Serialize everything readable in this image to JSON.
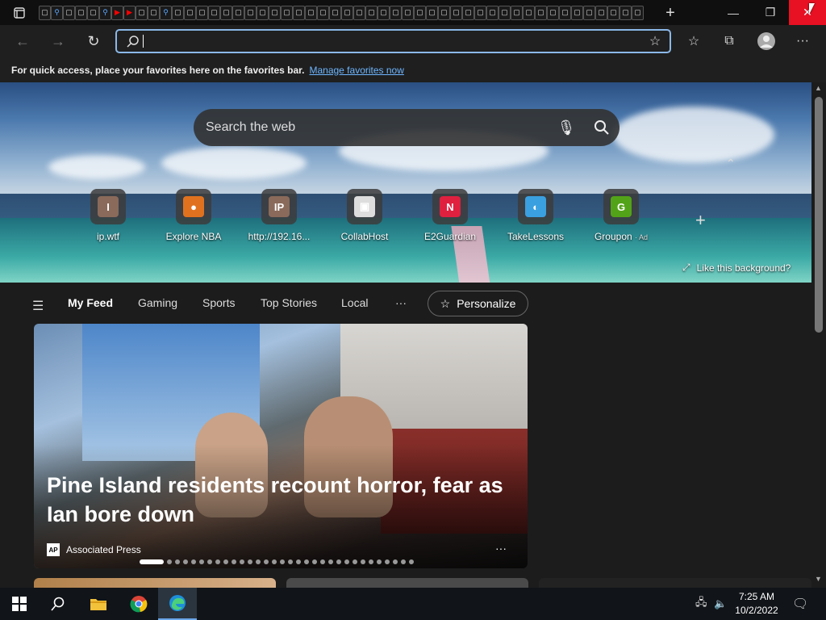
{
  "browser": {
    "tabs": [
      {
        "kind": "page"
      },
      {
        "kind": "search"
      },
      {
        "kind": "page"
      },
      {
        "kind": "page"
      },
      {
        "kind": "page"
      },
      {
        "kind": "search"
      },
      {
        "kind": "youtube"
      },
      {
        "kind": "youtube"
      },
      {
        "kind": "page"
      },
      {
        "kind": "page"
      },
      {
        "kind": "search"
      },
      {
        "kind": "page"
      },
      {
        "kind": "page"
      },
      {
        "kind": "page"
      },
      {
        "kind": "page"
      },
      {
        "kind": "page"
      },
      {
        "kind": "page"
      },
      {
        "kind": "page"
      },
      {
        "kind": "page"
      },
      {
        "kind": "page"
      },
      {
        "kind": "page"
      },
      {
        "kind": "page"
      },
      {
        "kind": "page"
      },
      {
        "kind": "page"
      },
      {
        "kind": "page"
      },
      {
        "kind": "page"
      },
      {
        "kind": "page"
      },
      {
        "kind": "page"
      },
      {
        "kind": "page"
      },
      {
        "kind": "page"
      },
      {
        "kind": "page"
      },
      {
        "kind": "page"
      },
      {
        "kind": "page"
      },
      {
        "kind": "page"
      },
      {
        "kind": "page"
      },
      {
        "kind": "page"
      },
      {
        "kind": "page"
      },
      {
        "kind": "page"
      },
      {
        "kind": "page"
      },
      {
        "kind": "page"
      },
      {
        "kind": "page"
      },
      {
        "kind": "page"
      },
      {
        "kind": "page"
      },
      {
        "kind": "page"
      },
      {
        "kind": "page"
      },
      {
        "kind": "page"
      },
      {
        "kind": "page"
      },
      {
        "kind": "page"
      },
      {
        "kind": "page"
      },
      {
        "kind": "page"
      }
    ],
    "address": {
      "value": "",
      "placeholder": ""
    },
    "favorites_bar": {
      "message": "For quick access, place your favorites here on the favorites bar.",
      "link": "Manage favorites now"
    }
  },
  "newtab": {
    "search_placeholder": "Search the web",
    "quick_links": [
      {
        "label": "ip.wtf",
        "badge": "",
        "icon": "I",
        "color": "#8a6a5a"
      },
      {
        "label": "Explore NBA",
        "badge": "",
        "icon": "●",
        "color": "#e0721f"
      },
      {
        "label": "http://192.16...",
        "badge": "",
        "icon": "IP",
        "color": "#8a6a5a"
      },
      {
        "label": "CollabHost",
        "badge": "",
        "icon": "▣",
        "color": "#dddddd"
      },
      {
        "label": "E2Guardian",
        "badge": "",
        "icon": "N",
        "color": "#e0203f"
      },
      {
        "label": "TakeLessons",
        "badge": "",
        "icon": "◐",
        "color": "#3aa0e0"
      },
      {
        "label": "Groupon",
        "badge": "· Ad",
        "icon": "G",
        "color": "#53a318"
      }
    ],
    "like_background": "Like this background?"
  },
  "feed": {
    "nav": [
      "My Feed",
      "Gaming",
      "Sports",
      "Top Stories",
      "Local"
    ],
    "more": "···",
    "personalize": "Personalize",
    "hero": {
      "headline": "Pine Island residents recount horror, fear as Ian bore down",
      "source": "Associated Press",
      "source_logo": "AP",
      "more": "···",
      "carousel_count": 32,
      "carousel_active": 0
    }
  },
  "taskbar": {
    "time": "7:25 AM",
    "date": "10/2/2022"
  }
}
